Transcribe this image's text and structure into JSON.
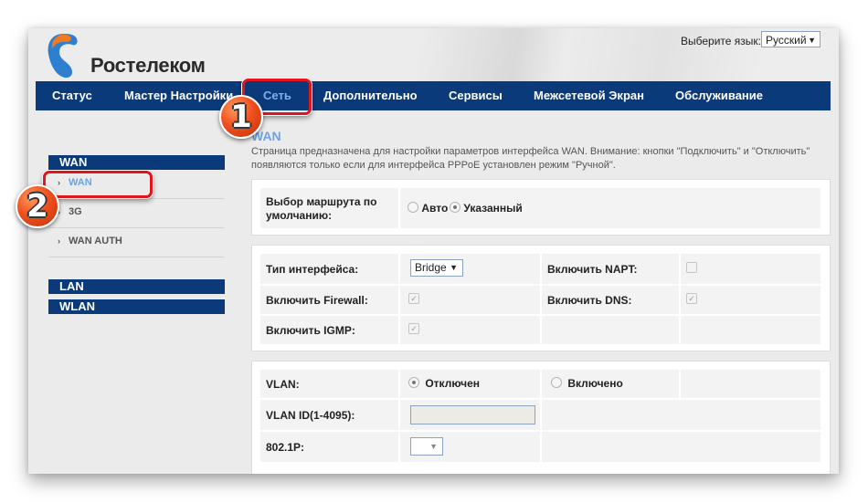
{
  "header": {
    "brand": "Ростелеком",
    "language_label": "Выберите язык:",
    "language_value": "Русский"
  },
  "nav": {
    "items": [
      {
        "label": "Статус"
      },
      {
        "label": "Мастер Настройки"
      },
      {
        "label": "Сеть",
        "active": true
      },
      {
        "label": "Дополнительно"
      },
      {
        "label": "Сервисы"
      },
      {
        "label": "Межсетевой Экран"
      },
      {
        "label": "Обслуживание"
      }
    ]
  },
  "sidebar": {
    "sections": [
      {
        "title": "WAN",
        "items": [
          {
            "label": "WAN",
            "active": true
          },
          {
            "label": "3G"
          },
          {
            "label": "WAN AUTH"
          }
        ]
      },
      {
        "title": "LAN"
      },
      {
        "title": "WLAN"
      }
    ]
  },
  "annotations": {
    "step1": "1",
    "step2": "2"
  },
  "main": {
    "title": "WAN",
    "description": "Страница предназначена для настройки параметров интерфейса WAN. Внимание: кнопки \"Подключить\" и \"Отключить\" появляются только если для интерфейса PPPoE установлен режим \"Ручной\".",
    "route": {
      "label": "Выбор маршрута по умолчанию:",
      "options": [
        {
          "label": "Авто",
          "selected": false
        },
        {
          "label": "Указанный",
          "selected": true
        }
      ]
    },
    "interface": {
      "type_label": "Тип интерфейса:",
      "type_value": "Bridge",
      "napt_label": "Включить NAPT:",
      "napt_checked": false,
      "firewall_label": "Включить Firewall:",
      "firewall_checked": true,
      "dns_label": "Включить DNS:",
      "dns_checked": true,
      "igmp_label": "Включить IGMP:",
      "igmp_checked": true
    },
    "vlan": {
      "label": "VLAN:",
      "off_label": "Отключен",
      "off_selected": true,
      "on_label": "Включено",
      "on_selected": false,
      "id_label": "VLAN ID(1-4095):",
      "id_value": "",
      "p_label": "802.1P:",
      "p_value": ""
    }
  },
  "colors": {
    "nav_bg": "#0a3a7a",
    "accent": "#6aa2e6",
    "highlight": "#e3141b"
  }
}
